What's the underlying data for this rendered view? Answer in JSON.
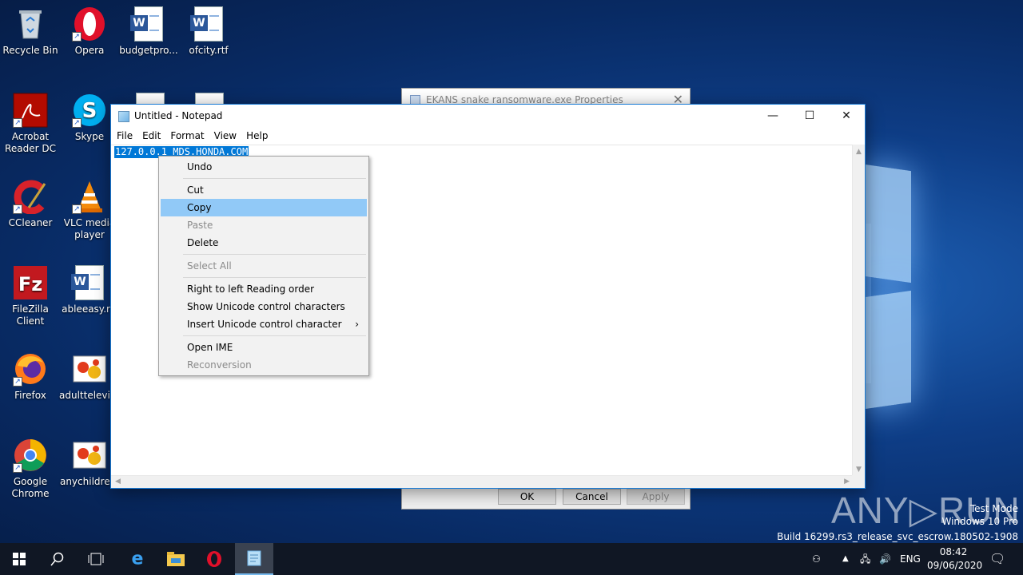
{
  "desktop": {
    "icons": [
      {
        "label": "Recycle Bin"
      },
      {
        "label": "Opera"
      },
      {
        "label": "budgetpro..."
      },
      {
        "label": "ofcity.rtf"
      },
      {
        "label": "Acrobat Reader DC"
      },
      {
        "label": "Skype"
      },
      {
        "label": "CCleaner"
      },
      {
        "label": "VLC media player"
      },
      {
        "label": "FileZilla Client"
      },
      {
        "label": "ableeasy.rtf"
      },
      {
        "label": "Firefox"
      },
      {
        "label": "adulttelevis..."
      },
      {
        "label": "Google Chrome"
      },
      {
        "label": "anychildre..."
      }
    ]
  },
  "props_window": {
    "title": "EKANS snake ransomware.exe Properties",
    "ok": "OK",
    "cancel": "Cancel",
    "apply": "Apply"
  },
  "notepad": {
    "title": "Untitled - Notepad",
    "menu": [
      "File",
      "Edit",
      "Format",
      "View",
      "Help"
    ],
    "text": "127.0.0.1 MDS.HONDA.COM",
    "minimize": "—",
    "maximize": "☐",
    "close": "✕"
  },
  "context_menu": {
    "items": [
      {
        "label": "Undo",
        "enabled": true
      },
      {
        "label": "Cut",
        "enabled": true
      },
      {
        "label": "Copy",
        "enabled": true,
        "highlighted": true
      },
      {
        "label": "Paste",
        "enabled": false
      },
      {
        "label": "Delete",
        "enabled": true
      },
      {
        "label": "Select All",
        "enabled": false
      },
      {
        "label": "Right to left Reading order",
        "enabled": true
      },
      {
        "label": "Show Unicode control characters",
        "enabled": true
      },
      {
        "label": "Insert Unicode control character",
        "enabled": true,
        "submenu": true
      },
      {
        "label": "Open IME",
        "enabled": true
      },
      {
        "label": "Reconversion",
        "enabled": false
      }
    ],
    "submenu_glyph": "›"
  },
  "watermark": {
    "brand": "ANY▷RUN",
    "line1": "Test Mode",
    "line2": "Windows 10 Pro",
    "line3": "Build 16299.rs3_release_svc_escrow.180502-1908"
  },
  "taskbar": {
    "tray_lang": "ENG",
    "time": "08:42",
    "date": "09/06/2020"
  },
  "colors": {
    "selection": "#0078d7",
    "menu_highlight": "#91c9f7",
    "taskbar": "#101724"
  }
}
